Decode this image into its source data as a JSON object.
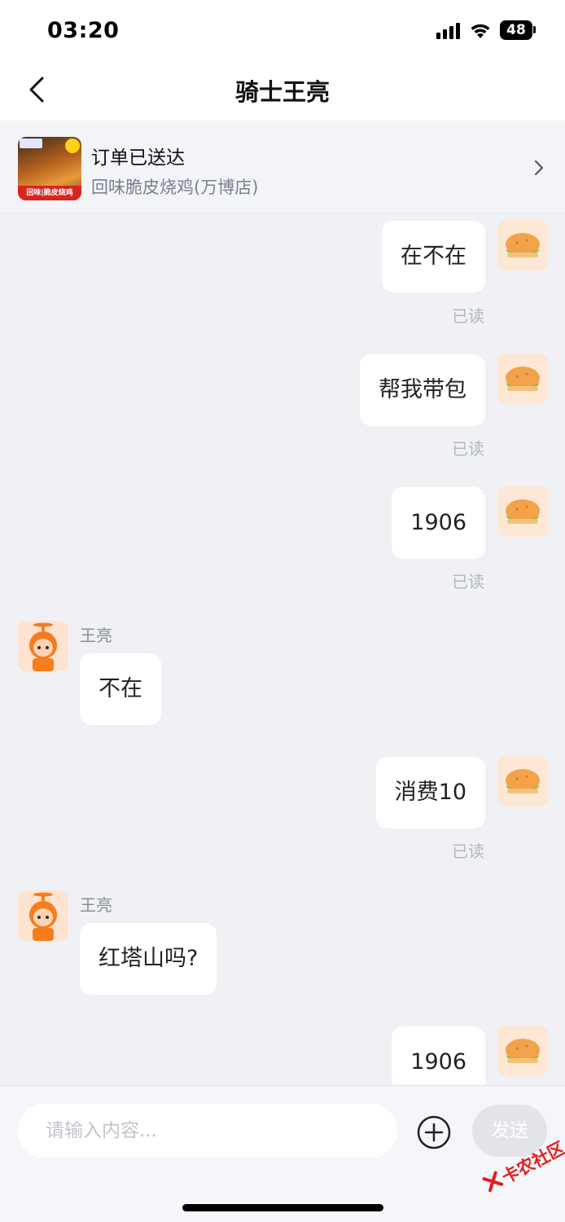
{
  "status_bar": {
    "time": "03:20",
    "battery": "48"
  },
  "header": {
    "title": "骑士王亮"
  },
  "order": {
    "status": "订单已送达",
    "store": "回味脆皮烧鸡(万博店)",
    "thumb_banner": "回味|脆皮烧鸡"
  },
  "messages": [
    {
      "side": "me",
      "text": "在不在",
      "read": "已读"
    },
    {
      "side": "me",
      "text": "帮我带包",
      "read": "已读"
    },
    {
      "side": "me",
      "text": "1906",
      "read": "已读"
    },
    {
      "side": "rider",
      "sender": "王亮",
      "text": "不在"
    },
    {
      "side": "me",
      "text": "消费10",
      "read": "已读"
    },
    {
      "side": "rider",
      "sender": "王亮",
      "text": "红塔山吗?"
    },
    {
      "side": "me",
      "text": "1906"
    }
  ],
  "input": {
    "placeholder": "请输入内容...",
    "send_label": "发送"
  },
  "watermark": "卡农社区",
  "icons": {
    "back": "back-arrow-icon",
    "chevron": "chevron-right-icon",
    "plus": "plus-circle-icon",
    "avatar_me": "burger-avatar-icon",
    "avatar_rider": "rider-avatar-icon"
  }
}
